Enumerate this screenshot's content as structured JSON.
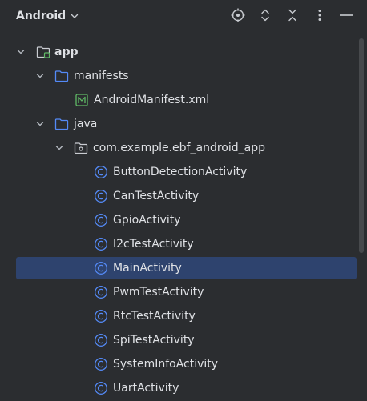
{
  "header": {
    "title": "Android"
  },
  "toolbar": {
    "icons": [
      "locate-icon",
      "expand-all-icon",
      "collapse-all-icon",
      "more-options-icon",
      "hide-icon"
    ]
  },
  "tree": {
    "app": "app",
    "manifests": "manifests",
    "manifest_file": "AndroidManifest.xml",
    "java": "java",
    "package": "com.example.ebf_android_app",
    "classes": [
      "ButtonDetectionActivity",
      "CanTestActivity",
      "GpioActivity",
      "I2cTestActivity",
      "MainActivity",
      "PwmTestActivity",
      "RtcTestActivity",
      "SpiTestActivity",
      "SystemInfoActivity",
      "UartActivity"
    ],
    "selected_class": "MainActivity"
  },
  "colors": {
    "background": "#2b2d30",
    "selection": "#2e436e",
    "folder_blue": "#548af7",
    "manifest_green": "#5fb865",
    "class_blue": "#548af7"
  }
}
